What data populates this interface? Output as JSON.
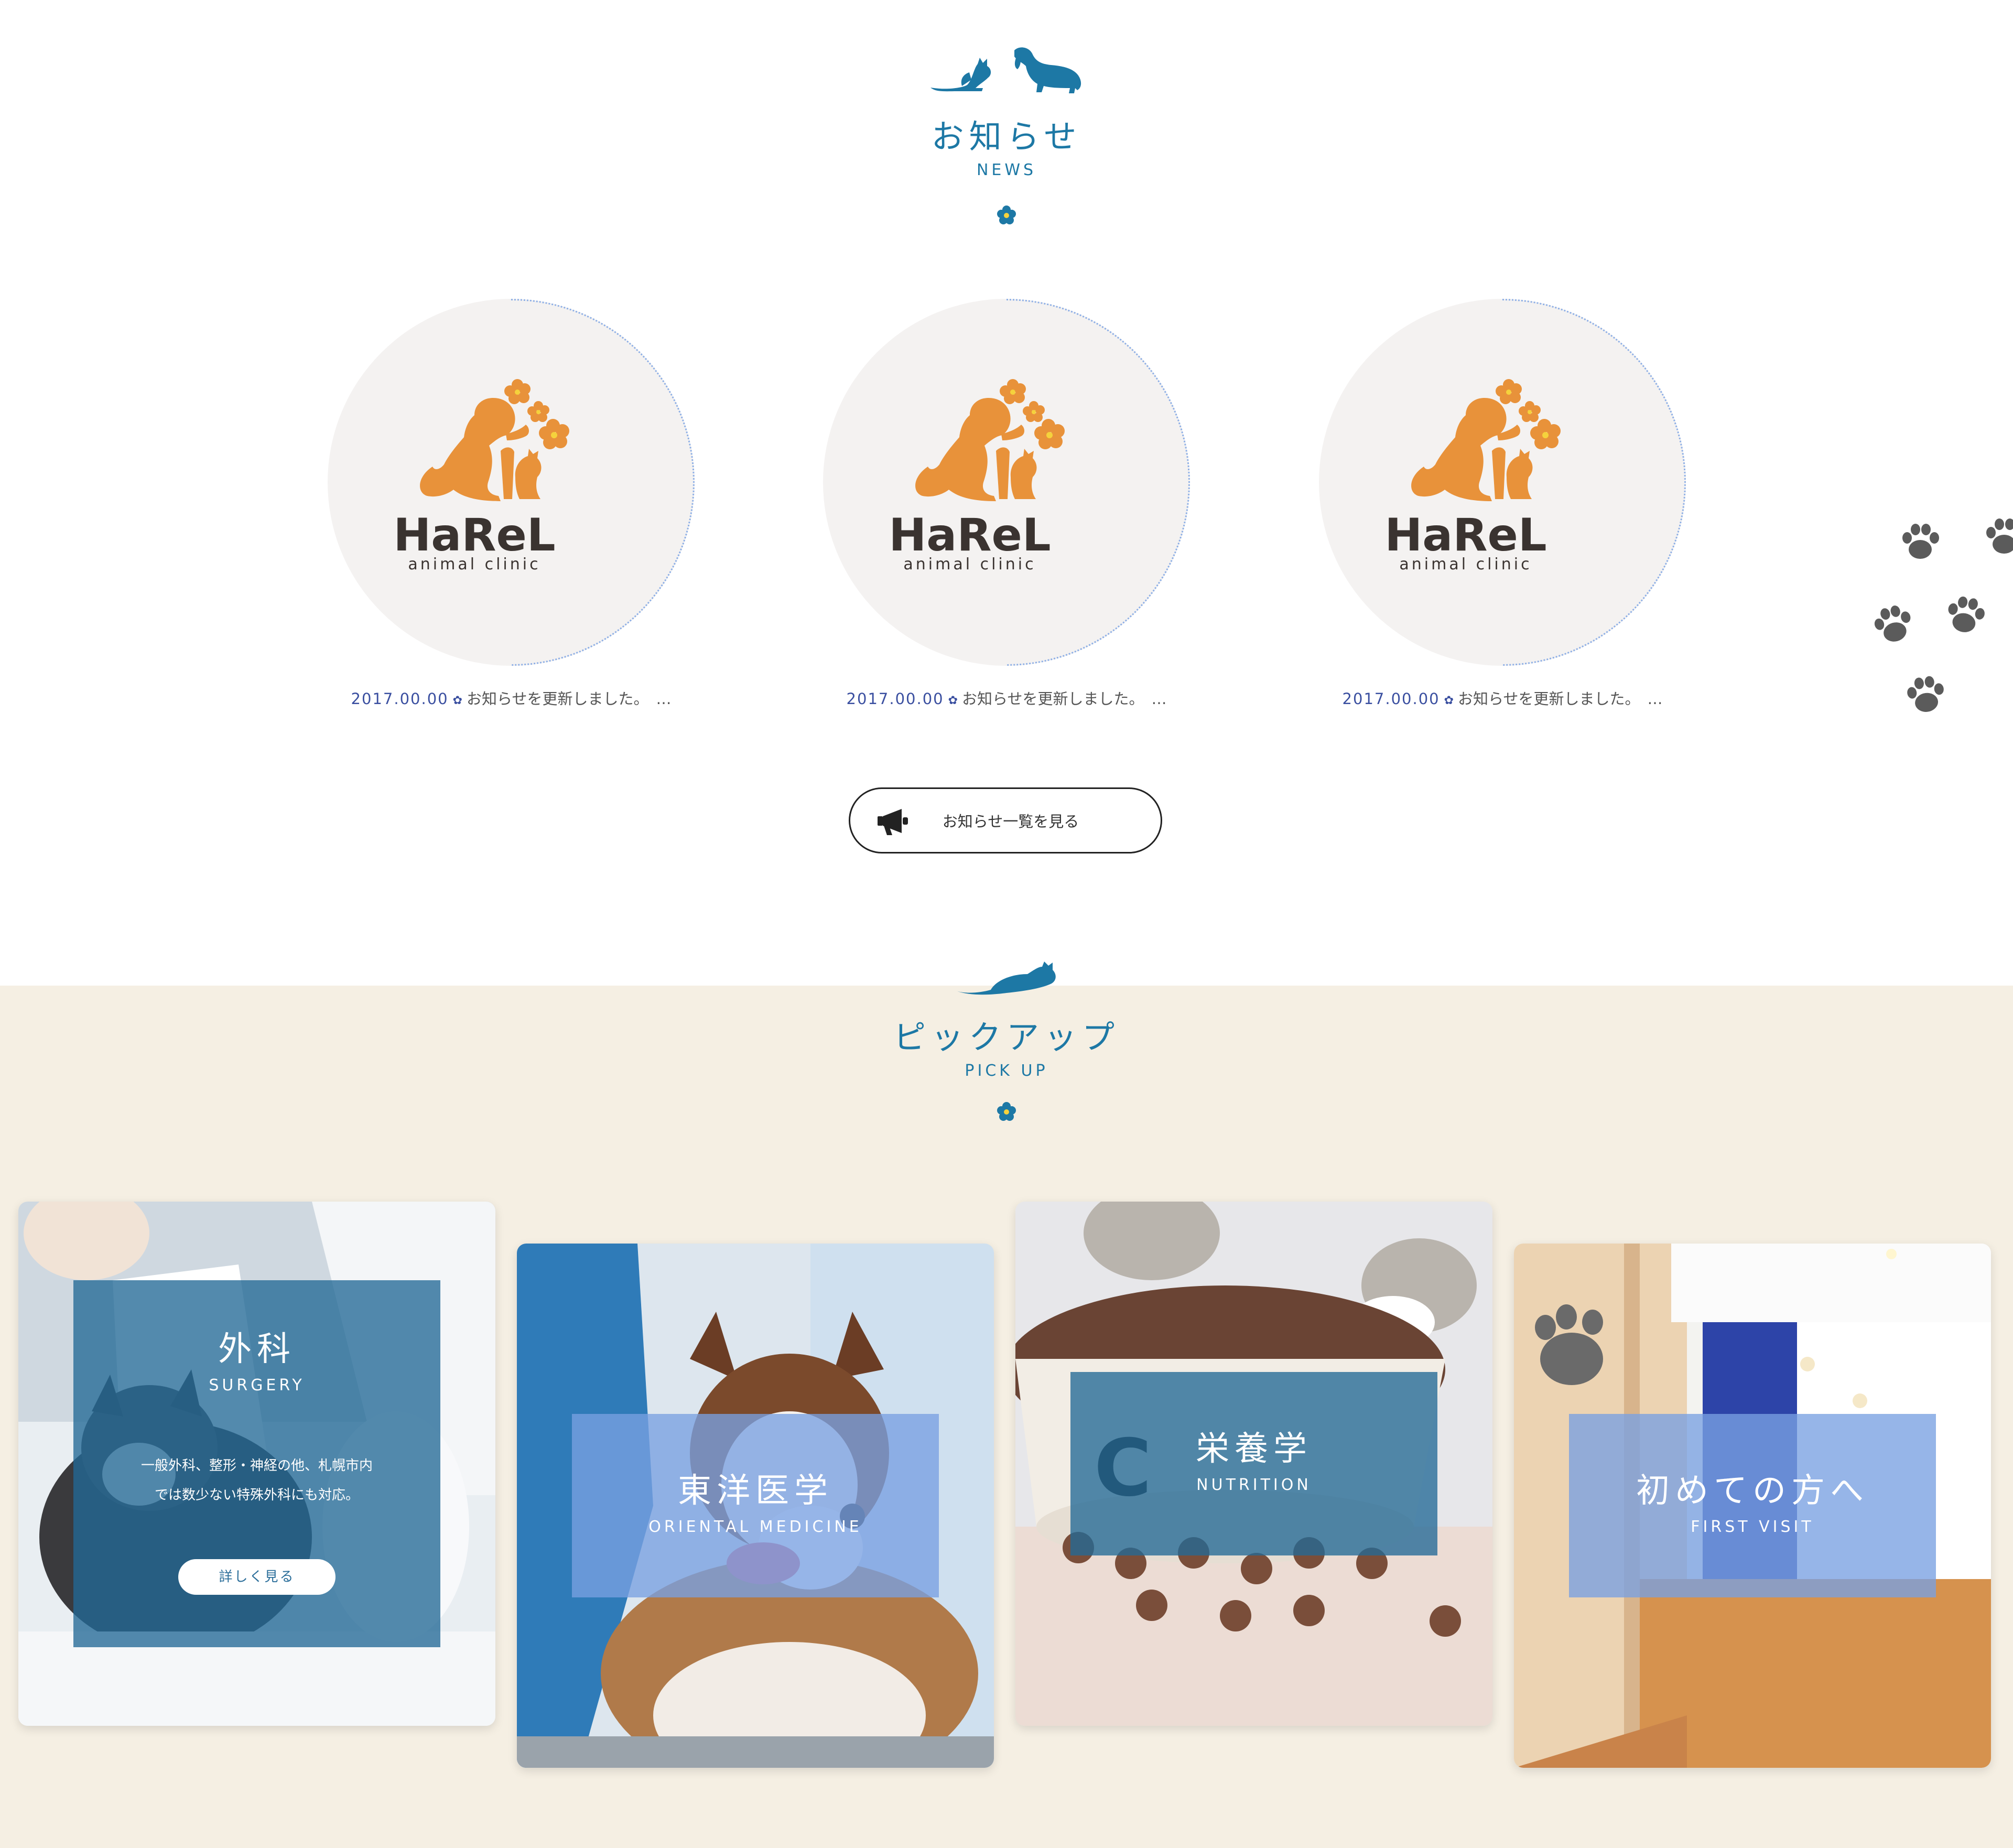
{
  "news": {
    "heading": {
      "title": "お知らせ",
      "subtitle": "NEWS"
    },
    "items": [
      {
        "logo_name": "HaReL",
        "logo_tagline": "animal clinic",
        "date": "2017.00.00",
        "text": "お知らせを更新しました。",
        "ellipsis": "…"
      },
      {
        "logo_name": "HaReL",
        "logo_tagline": "animal clinic",
        "date": "2017.00.00",
        "text": "お知らせを更新しました。",
        "ellipsis": "…"
      },
      {
        "logo_name": "HaReL",
        "logo_tagline": "animal clinic",
        "date": "2017.00.00",
        "text": "お知らせを更新しました。",
        "ellipsis": "…"
      }
    ],
    "list_button": {
      "label": "お知らせ一覧を見る",
      "icon": "megaphone-icon"
    }
  },
  "pickup": {
    "heading": {
      "title": "ピックアップ",
      "subtitle": "PICK UP"
    },
    "cards": [
      {
        "title": "外科",
        "subtitle": "SURGERY",
        "description_line1": "一般外科、整形・神経の他、札幌市内",
        "description_line2": "では数少ない特殊外科にも対応。",
        "button_label": "詳しく見る"
      },
      {
        "title": "東洋医学",
        "subtitle": "ORIENTAL MEDICINE"
      },
      {
        "title": "栄養学",
        "subtitle": "NUTRITION"
      },
      {
        "title": "初めての方へ",
        "subtitle": "FIRST VISIT"
      }
    ]
  },
  "colors": {
    "accent_blue": "#1d78a5",
    "news_date_blue": "#3a4fa0",
    "logo_orange": "#e8923a",
    "pickup_bg": "#f5efe3",
    "overlay_dark_blue": "rgba(35,105,150,0.78)",
    "overlay_light_blue": "rgba(120,160,225,0.78)"
  }
}
